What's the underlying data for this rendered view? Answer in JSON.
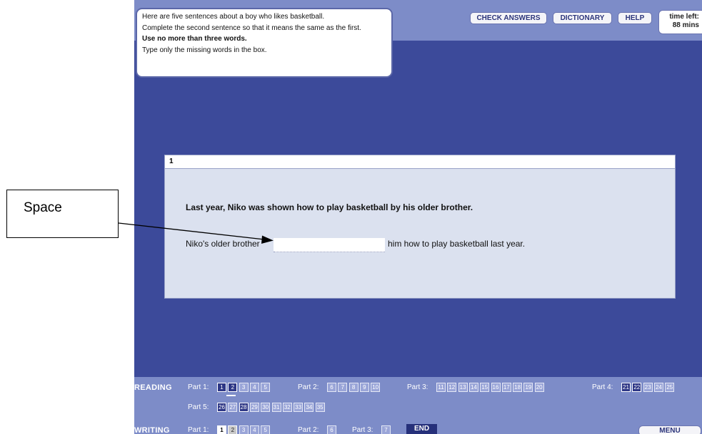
{
  "instructions": {
    "lines": [
      "Here are five sentences about a boy who likes basketball.",
      "Complete the second sentence so that it means the same as the first.",
      "Use no more than three words.",
      "Type only the missing words in the box."
    ]
  },
  "toolbar": {
    "check_answers": "CHECK ANSWERS",
    "dictionary": "DICTIONARY",
    "help": "HELP",
    "time_label": "time left:",
    "time_value": "88 mins"
  },
  "question": {
    "number": "1",
    "prompt": "Last year, Niko was shown how to play basketball by his older brother.",
    "before_blank": "Niko's older brother",
    "after_blank": "him how to play basketball last year.",
    "answer_value": ""
  },
  "callout": {
    "label": "Space"
  },
  "nav": {
    "reading_label": "READING",
    "writing_label": "WRITING",
    "reading_parts": [
      {
        "label": "Part 1:",
        "items": [
          {
            "n": "1",
            "state": "answered"
          },
          {
            "n": "2",
            "state": "answered"
          },
          {
            "n": "3",
            "state": "pending"
          },
          {
            "n": "4",
            "state": "pending"
          },
          {
            "n": "5",
            "state": "pending"
          }
        ]
      },
      {
        "label": "Part 2:",
        "items": [
          {
            "n": "6",
            "state": "pending"
          },
          {
            "n": "7",
            "state": "pending"
          },
          {
            "n": "8",
            "state": "pending"
          },
          {
            "n": "9",
            "state": "pending"
          },
          {
            "n": "10",
            "state": "pending"
          }
        ]
      },
      {
        "label": "Part 3:",
        "items": [
          {
            "n": "11",
            "state": "pending"
          },
          {
            "n": "12",
            "state": "pending"
          },
          {
            "n": "13",
            "state": "pending"
          },
          {
            "n": "14",
            "state": "pending"
          },
          {
            "n": "15",
            "state": "pending"
          },
          {
            "n": "16",
            "state": "pending"
          },
          {
            "n": "17",
            "state": "pending"
          },
          {
            "n": "18",
            "state": "pending"
          },
          {
            "n": "19",
            "state": "pending"
          },
          {
            "n": "20",
            "state": "pending"
          }
        ]
      },
      {
        "label": "Part 4:",
        "items": [
          {
            "n": "21",
            "state": "answered"
          },
          {
            "n": "22",
            "state": "answered"
          },
          {
            "n": "23",
            "state": "pending"
          },
          {
            "n": "24",
            "state": "pending"
          },
          {
            "n": "25",
            "state": "pending"
          }
        ]
      },
      {
        "label": "Part 5:",
        "items": [
          {
            "n": "26",
            "state": "answered"
          },
          {
            "n": "27",
            "state": "pending"
          },
          {
            "n": "28",
            "state": "answered"
          },
          {
            "n": "29",
            "state": "pending"
          },
          {
            "n": "30",
            "state": "pending"
          },
          {
            "n": "31",
            "state": "pending"
          },
          {
            "n": "32",
            "state": "pending"
          },
          {
            "n": "33",
            "state": "pending"
          },
          {
            "n": "34",
            "state": "pending"
          },
          {
            "n": "35",
            "state": "pending"
          }
        ]
      }
    ],
    "writing_parts": [
      {
        "label": "Part 1:",
        "items": [
          {
            "n": "1",
            "state": "current"
          },
          {
            "n": "2",
            "state": "visited"
          },
          {
            "n": "3",
            "state": "pending"
          },
          {
            "n": "4",
            "state": "pending"
          },
          {
            "n": "5",
            "state": "pending"
          }
        ]
      },
      {
        "label": "Part 2:",
        "items": [
          {
            "n": "6",
            "state": "pending"
          }
        ]
      },
      {
        "label": "Part 3:",
        "items": [
          {
            "n": "7",
            "state": "pending"
          }
        ]
      }
    ],
    "end_label": "END",
    "menu_label": "MENU"
  },
  "colors": {
    "background": "#3c4a9a",
    "band": "#7d8cc8",
    "answered": "#2e3786",
    "pending": "#9aa5d8"
  }
}
